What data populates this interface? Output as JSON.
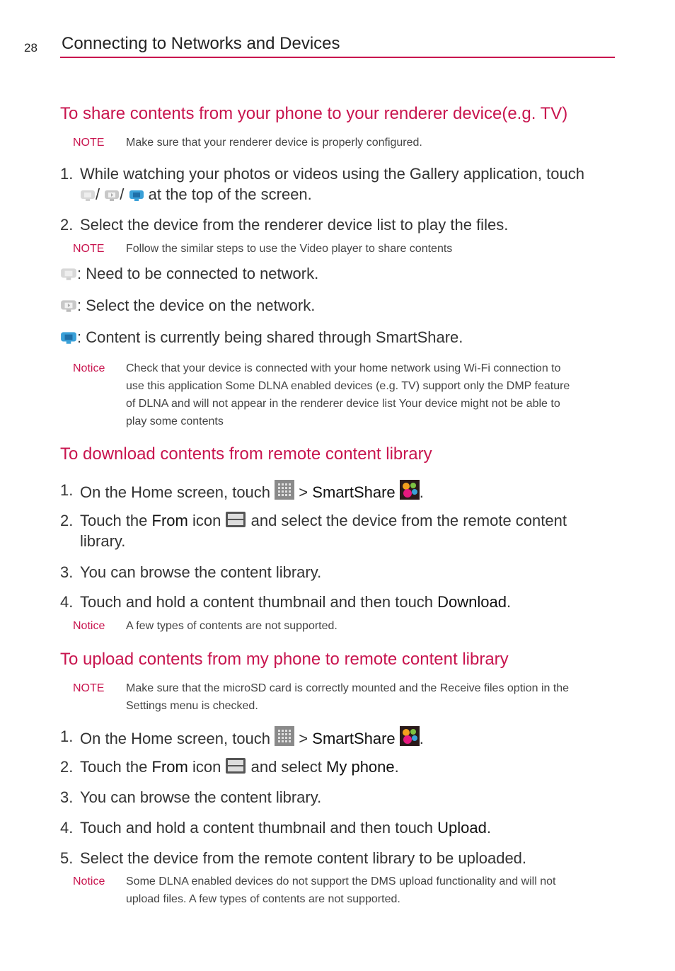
{
  "header": {
    "page_number": "28",
    "chapter_title": "Connecting to Networks and Devices"
  },
  "section1": {
    "heading": "To share contents from your phone to your renderer device(e.g. TV)",
    "note1": {
      "label": "NOTE",
      "text": "Make sure that your renderer device is properly configured."
    },
    "step1": {
      "num": "1.",
      "text_a": "While watching your photos or videos using the Gallery application, touch",
      "sep": "/",
      "text_b": "at the top of the screen."
    },
    "step2": {
      "num": "2.",
      "text": "Select the device from the renderer device list to play the files."
    },
    "note2": {
      "label": "NOTE",
      "text": "Follow the similar steps to use the Video player to share contents"
    },
    "legend": [
      {
        "icon": "share-disconnected-icon",
        "text": ": Need to be connected to network."
      },
      {
        "icon": "share-select-icon",
        "text": ": Select the device on the network."
      },
      {
        "icon": "share-active-icon",
        "text": ": Content is currently being shared through SmartShare."
      }
    ],
    "notice": {
      "label": "Notice",
      "lines": [
        "Check that your device is connected with your home network using Wi-Fi connection to",
        "use this application Some DLNA enabled devices (e.g. TV) support only the DMP feature",
        "of DLNA and will not appear in the renderer device list Your device might not be able to",
        "play some contents"
      ]
    }
  },
  "section2": {
    "heading": "To download contents from remote content library",
    "step1": {
      "num": "1.",
      "a": "On the Home screen, touch",
      "gt": ">",
      "app": "SmartShare",
      "end": "."
    },
    "step2": {
      "num": "2.",
      "a": "Touch the",
      "from": "From",
      "b": "icon",
      "c": "and select the device from the remote content",
      "d": "library."
    },
    "step3": {
      "num": "3.",
      "text": "You can browse the content library."
    },
    "step4": {
      "num": "4.",
      "a": "Touch and hold a content thumbnail and then touch",
      "action": "Download",
      "end": "."
    },
    "notice": {
      "label": "Notice",
      "text": "A few types of contents are not supported."
    }
  },
  "section3": {
    "heading": "To upload contents from my phone to remote content library",
    "note": {
      "label": "NOTE",
      "lines": [
        "Make sure that the microSD card is correctly mounted and the Receive files option in the",
        "Settings menu is checked."
      ]
    },
    "step1": {
      "num": "1.",
      "a": "On the Home screen, touch",
      "gt": ">",
      "app": "SmartShare",
      "end": "."
    },
    "step2": {
      "num": "2.",
      "a": "Touch the",
      "from": "From",
      "b": "icon",
      "c": "and select",
      "target": "My phone",
      "end": "."
    },
    "step3": {
      "num": "3.",
      "text": "You can browse the content library."
    },
    "step4": {
      "num": "4.",
      "a": "Touch and hold a content thumbnail and then touch",
      "action": "Upload",
      "end": "."
    },
    "step5": {
      "num": "5.",
      "text": "Select the device from the remote content library to be uploaded."
    },
    "notice": {
      "label": "Notice",
      "lines": [
        "Some DLNA enabled devices do not support the DMS upload functionality and will not",
        "upload files. A few types of contents are not supported."
      ]
    }
  },
  "colors": {
    "accent": "#c8144e",
    "icon_blue": "#3aa0d8"
  }
}
